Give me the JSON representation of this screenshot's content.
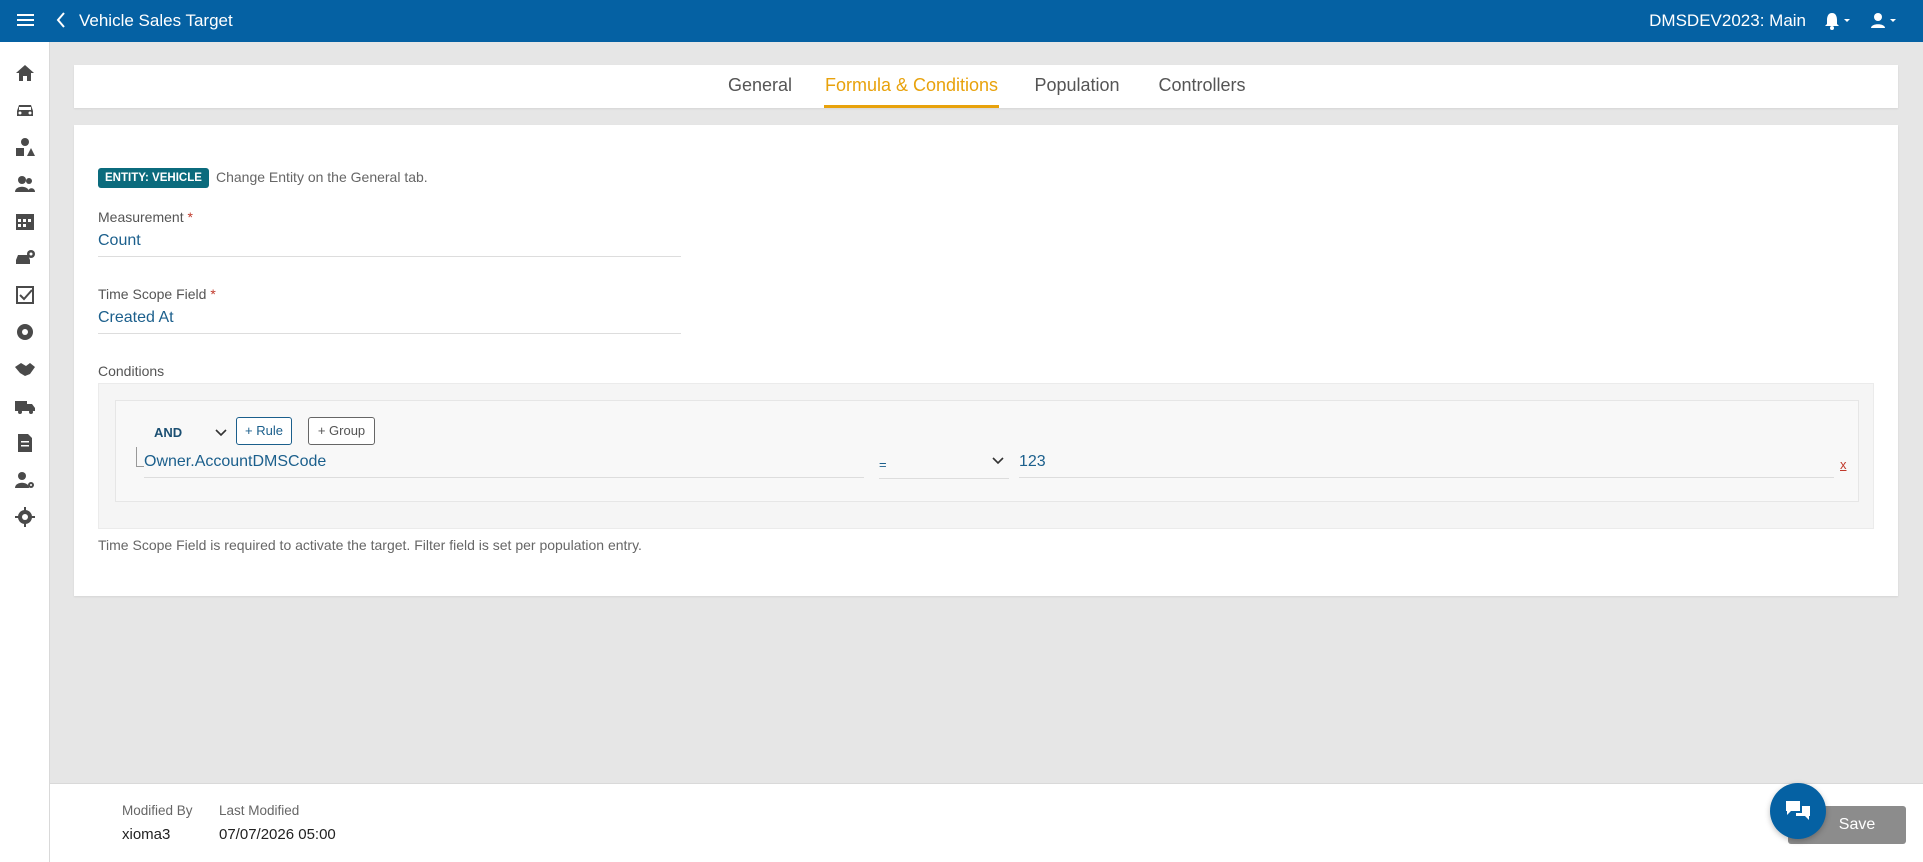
{
  "header": {
    "title": "Vehicle Sales Target",
    "environment": "DMSDEV2023: Main",
    "icons": [
      "menu-icon",
      "back-arrow-icon",
      "bell-icon",
      "user-icon"
    ]
  },
  "sidebar": {
    "items": [
      "home-icon",
      "car-icon",
      "shapes-icon",
      "people-icon",
      "calendar-icon",
      "car-gear-icon",
      "checklist-icon",
      "tire-icon",
      "handshake-icon",
      "truck-icon",
      "document-icon",
      "user-gear-icon",
      "settings-icon"
    ]
  },
  "tabs": [
    {
      "label": "General"
    },
    {
      "label": "Formula & Conditions"
    },
    {
      "label": "Population"
    },
    {
      "label": "Controllers"
    }
  ],
  "active_tab": "Formula & Conditions",
  "entity": {
    "badge": "ENTITY: VEHICLE",
    "hint": "Change Entity on the General tab."
  },
  "measurement": {
    "label": "Measurement",
    "required_mark": "*",
    "value": "Count"
  },
  "time_scope": {
    "label": "Time Scope Field",
    "required_mark": "*",
    "value": "Created At"
  },
  "conditions": {
    "label": "Conditions",
    "combinator": "AND",
    "add_rule_label": "+ Rule",
    "add_group_label": "+ Group",
    "rules": [
      {
        "field": "Owner.AccountDMSCode",
        "operator": "=",
        "value": "123",
        "remove_label": "x"
      }
    ]
  },
  "footer_note": "Time Scope Field is required to activate the target. Filter field is set per population entry.",
  "meta": {
    "modified_by_label": "Modified By",
    "modified_by": "xioma3",
    "last_modified_label": "Last Modified",
    "last_modified": "07/07/2026 05:00"
  },
  "actions": {
    "save_label": "Save"
  },
  "colors": {
    "header": "#0561a3",
    "active_tab": "#e8a20c",
    "entity_badge": "#0b6b7d",
    "link_value": "#1b5f8c"
  }
}
